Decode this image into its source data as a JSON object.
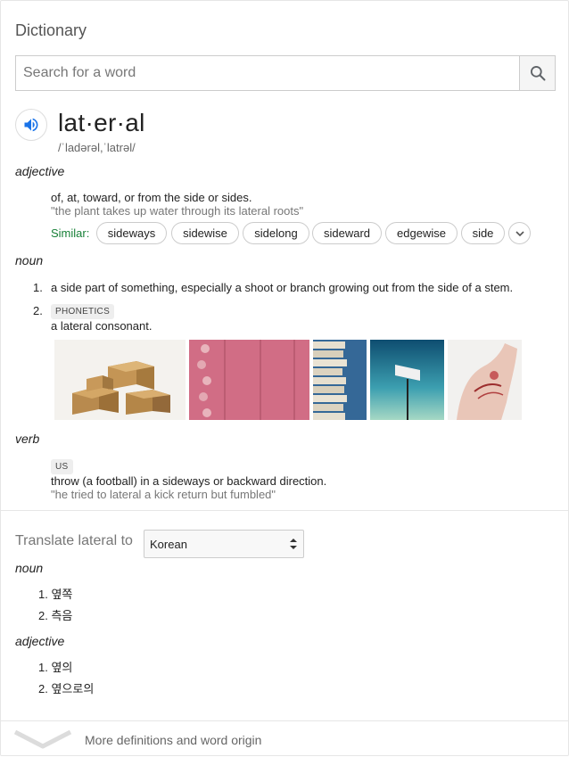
{
  "title": "Dictionary",
  "search": {
    "placeholder": "Search for a word",
    "value": ""
  },
  "entry": {
    "headword": "lat·er·al",
    "pronunciation": "/ˈladərəl,ˈlatrəl/",
    "adjective": {
      "pos": "adjective",
      "definition": "of, at, toward, or from the side or sides.",
      "example": "\"the plant takes up water through its lateral roots\"",
      "similar_label": "Similar:",
      "similar": [
        "sideways",
        "sidewise",
        "sidelong",
        "sideward",
        "edgewise",
        "side"
      ]
    },
    "noun": {
      "pos": "noun",
      "senses": [
        {
          "num": "1.",
          "definition": "a side part of something, especially a shoot or branch growing out from the side of a stem."
        },
        {
          "num": "2.",
          "tag": "PHONETICS",
          "definition": "a lateral consonant."
        }
      ]
    },
    "images": [
      "cardboard-boxes",
      "pink-wood-flowers",
      "stacked-books",
      "billboard-sky",
      "neck-illustration"
    ],
    "verb": {
      "pos": "verb",
      "tag": "US",
      "definition": "throw (a football) in a sideways or backward direction.",
      "example": "\"he tried to lateral a kick return but fumbled\""
    }
  },
  "translate": {
    "label": "Translate lateral to",
    "language": "Korean",
    "groups": [
      {
        "pos": "noun",
        "items": [
          {
            "num": "1.",
            "text": "옆쪽"
          },
          {
            "num": "2.",
            "text": "측음"
          }
        ]
      },
      {
        "pos": "adjective",
        "items": [
          {
            "num": "1.",
            "text": "옆의"
          },
          {
            "num": "2.",
            "text": "옆으로의"
          }
        ]
      }
    ]
  },
  "footer": {
    "more_label": "More definitions and word origin"
  },
  "colors": {
    "similar_green": "#188038",
    "speaker_blue": "#1a73e8"
  }
}
